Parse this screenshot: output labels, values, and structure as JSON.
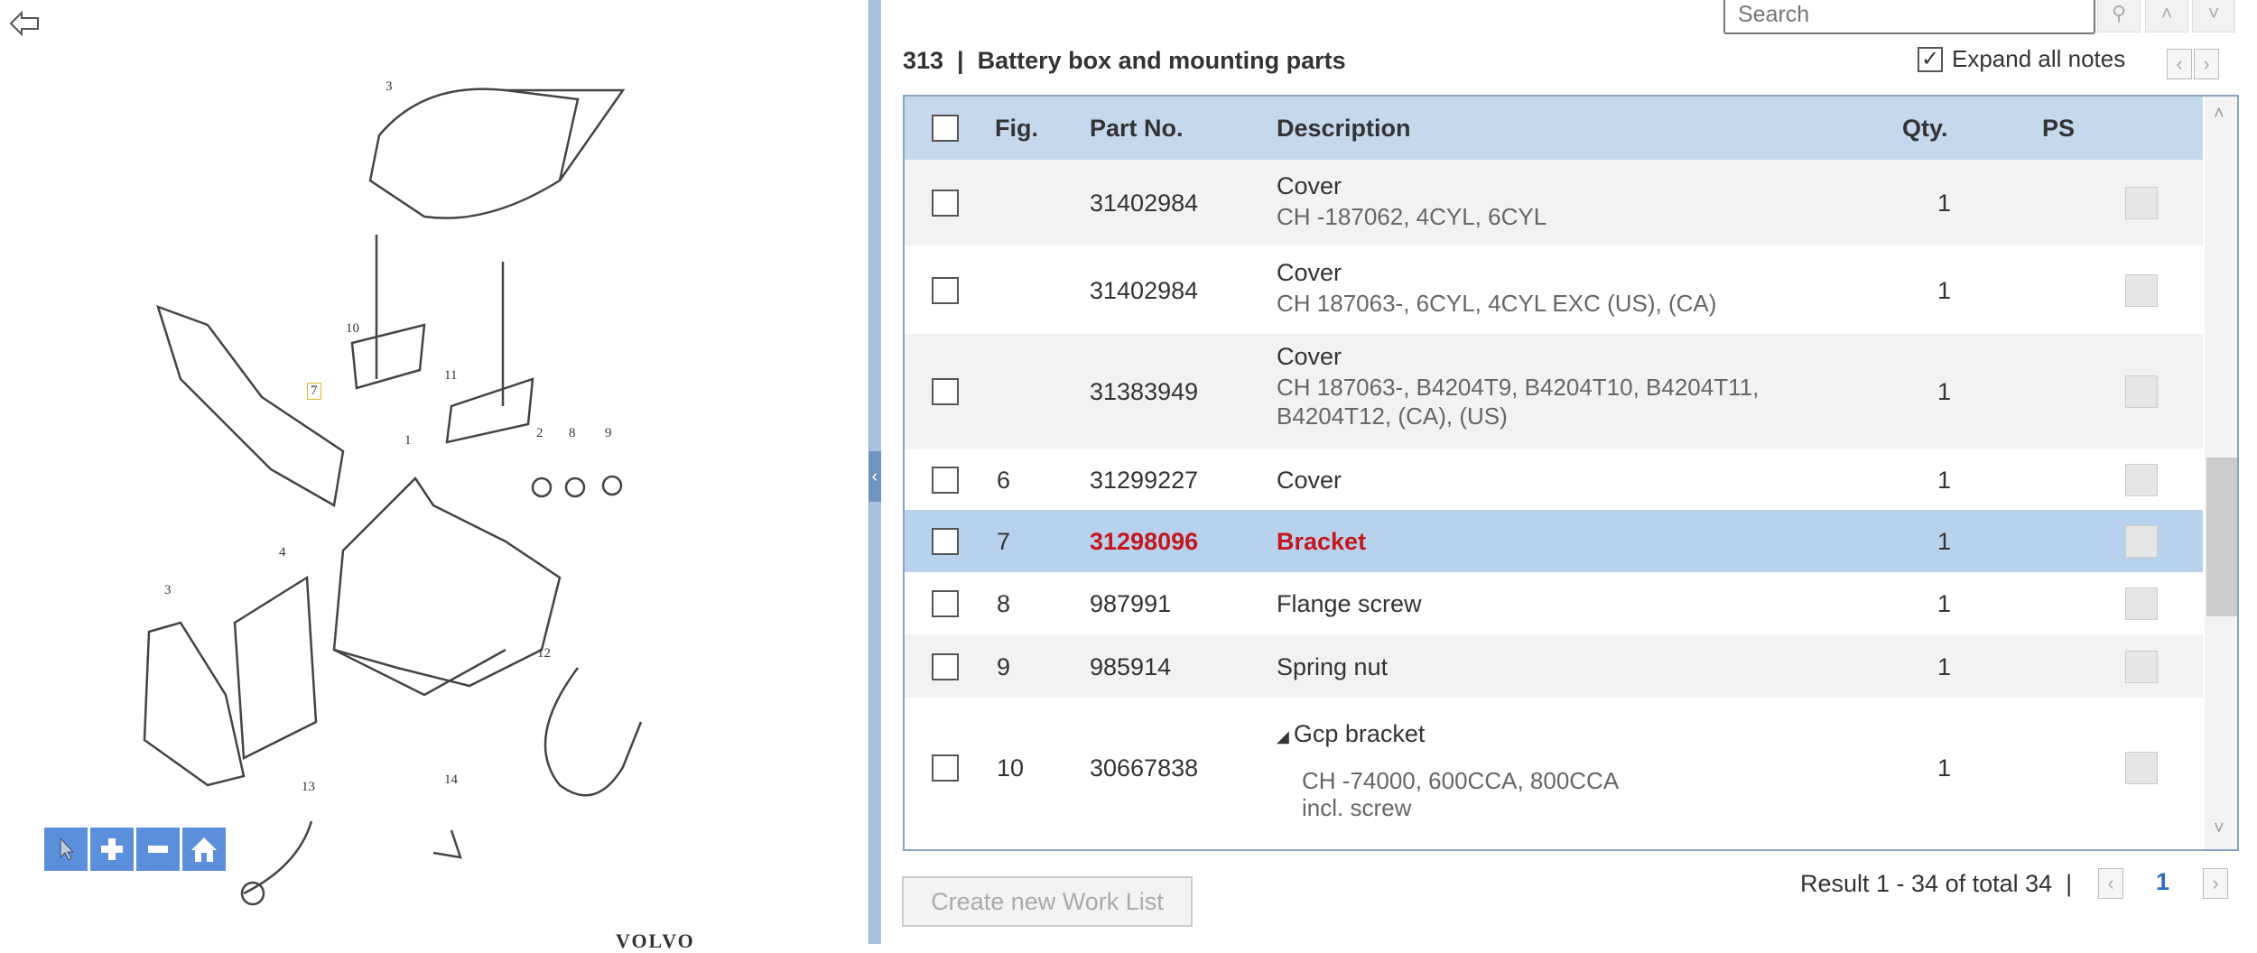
{
  "diagram": {
    "callouts": [
      "3",
      "10",
      "11",
      "7",
      "1",
      "2",
      "8",
      "9",
      "4",
      "3",
      "12",
      "13",
      "14"
    ],
    "logo": "VOLVO",
    "tools": [
      "pointer-icon",
      "zoom-in-icon",
      "zoom-out-icon",
      "home-icon"
    ]
  },
  "search": {
    "placeholder": "Search"
  },
  "header": {
    "title": "313  |  Battery box and mounting parts",
    "expand_label": "Expand all notes",
    "expand_checked": true
  },
  "table": {
    "columns": [
      "Fig.",
      "Part No.",
      "Description",
      "Qty.",
      "PS"
    ],
    "rows": [
      {
        "fig": "",
        "part": "31402984",
        "desc": "Cover",
        "note": "CH -187062, 4CYL, 6CYL",
        "qty": "1"
      },
      {
        "fig": "",
        "part": "31402984",
        "desc": "Cover",
        "note": "CH 187063-, 6CYL, 4CYL EXC (US), (CA)",
        "qty": "1"
      },
      {
        "fig": "",
        "part": "31383949",
        "desc": "Cover",
        "note": "CH 187063-, B4204T9, B4204T10, B4204T11,",
        "note2": "B4204T12, (CA), (US)",
        "qty": "1"
      },
      {
        "fig": "6",
        "part": "31299227",
        "desc": "Cover",
        "qty": "1"
      },
      {
        "fig": "7",
        "part": "31298096",
        "desc": "Bracket",
        "qty": "1",
        "selected": true
      },
      {
        "fig": "8",
        "part": "987991",
        "desc": "Flange screw",
        "qty": "1"
      },
      {
        "fig": "9",
        "part": "985914",
        "desc": "Spring nut",
        "qty": "1"
      },
      {
        "fig": "10",
        "part": "30667838",
        "desc": "Gcp bracket",
        "note": "CH -74000, 600CCA, 800CCA",
        "note2": "incl. screw",
        "qty": "1"
      }
    ]
  },
  "footer": {
    "create_label": "Create new Work List",
    "result": "Result 1 - 34 of total 34",
    "page": "1"
  },
  "colors": {
    "accent": "#c6d9ec",
    "selected_row": "#b8d2ee",
    "highlight_text": "#c4161c",
    "tool_button": "#5b8fdc"
  }
}
